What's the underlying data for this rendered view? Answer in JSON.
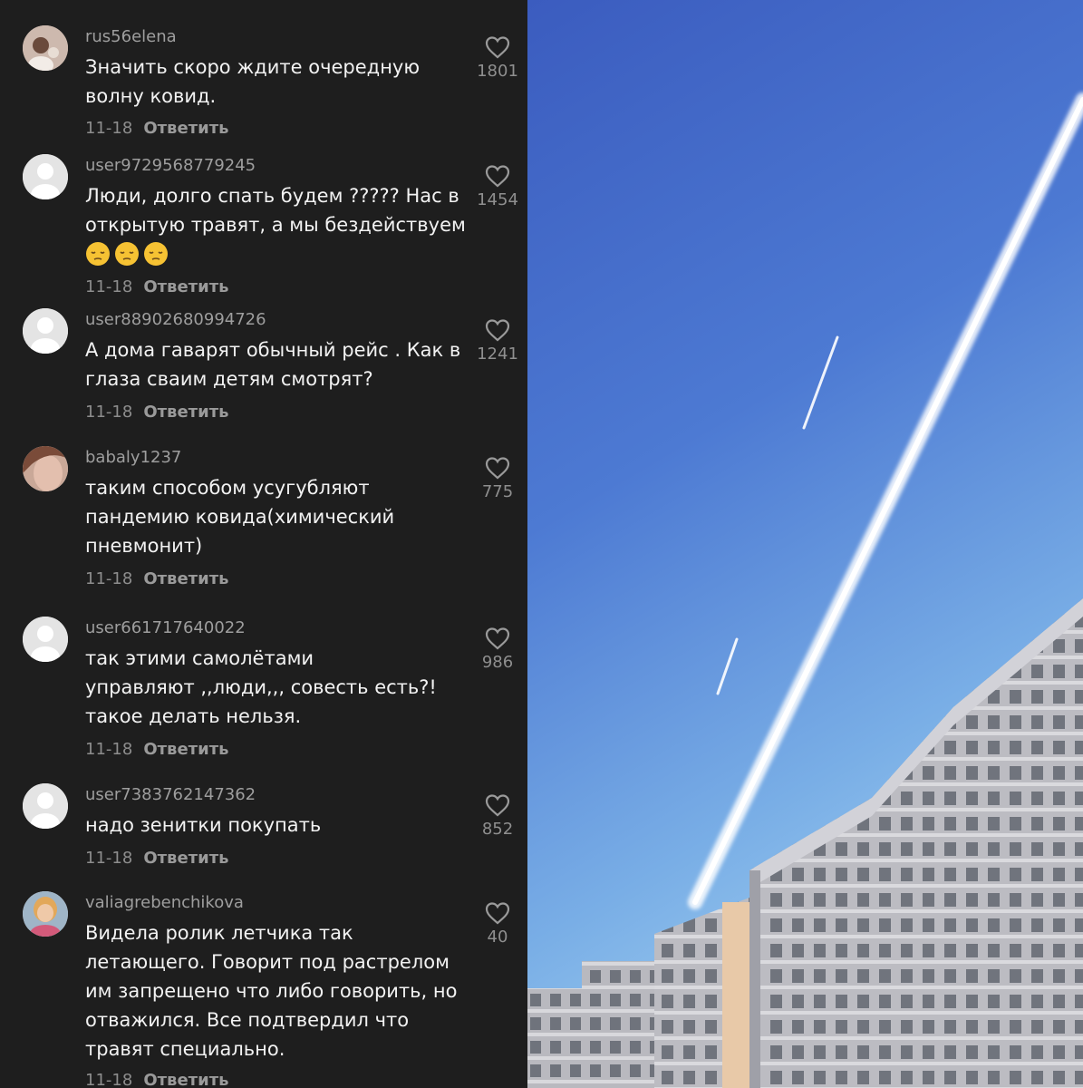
{
  "comments": [
    {
      "username": "rus56elena",
      "text": "Значить скоро ждите очередную\nволну ковид.",
      "date": "11-18",
      "reply": "Ответить",
      "likes": "1801"
    },
    {
      "username": "user9729568779245",
      "text": "Люди, долго спать будем ????? Нас в\nоткрытую травят, а мы бездействуем",
      "emojis": [
        "pensive-face",
        "pensive-face",
        "pensive-face"
      ],
      "date": "11-18",
      "reply": "Ответить",
      "likes": "1454"
    },
    {
      "username": "user88902680994726",
      "text": "А дома гаварят обычный рейс . Как в\nглаза сваим детям смотрят?",
      "date": "11-18",
      "reply": "Ответить",
      "likes": "1241"
    },
    {
      "username": "babaly1237",
      "text": "таким способом усугубляют\nпандемию ковида(химический\nпневмонит)",
      "date": "11-18",
      "reply": "Ответить",
      "likes": "775"
    },
    {
      "username": "user661717640022",
      "text": "так этими самолётами\nуправляют ,,люди,,, совесть есть?!\nтакое делать нельзя.",
      "date": "11-18",
      "reply": "Ответить",
      "likes": "986"
    },
    {
      "username": "user7383762147362",
      "text": "надо зенитки покупать",
      "date": "11-18",
      "reply": "Ответить",
      "likes": "852"
    },
    {
      "username": "valiagrebenchikova",
      "text": "Видела ролик летчика так\nлетающего. Говорит под растрелом\nим запрещено что либо говорить, но\nотважился. Все подтвердил что\nтравят специально.",
      "date": "11-18",
      "reply": "Ответить",
      "likes": "40"
    }
  ],
  "icons": {
    "like": "heart-outline-icon",
    "avatar_default": "default-avatar-icon"
  },
  "colors": {
    "background": "#1e1e1e",
    "username": "#9e9e9e",
    "text": "#f2f2f2",
    "meta": "#8d8d8d",
    "sky_top": "#3f63c4",
    "sky_bottom": "#8cc3ec"
  }
}
